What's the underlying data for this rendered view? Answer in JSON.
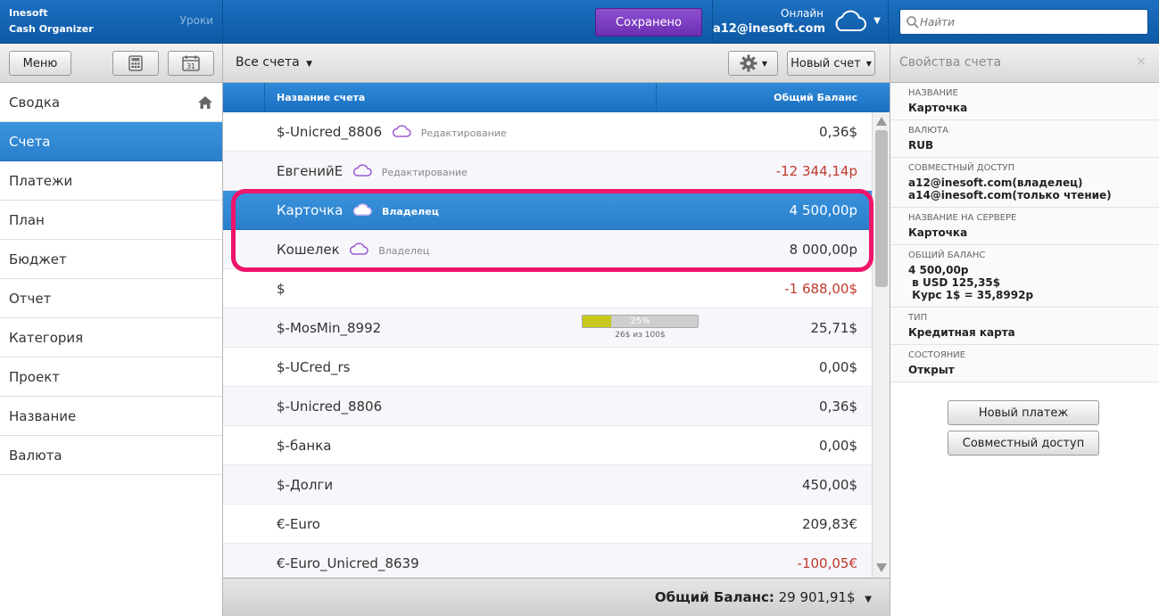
{
  "header": {
    "brand_line1": "Inesoft",
    "brand_line2": "Cash Organizer",
    "lessons_label": "Уроки",
    "saved_label": "Сохранено",
    "status_label": "Онлайн",
    "user_email": "a12@inesoft.com",
    "search_placeholder": "Найти",
    "saved_button_color": "#7b3fc4",
    "header_color": "#1565b8"
  },
  "toolbar": {
    "menu_label": "Меню",
    "calc_icon": "calculator-icon",
    "calendar_icon": "calendar-icon",
    "calendar_day": "31",
    "filter_label": "Все счета",
    "new_account_label": "Новый счет",
    "settings_icon": "gear-icon",
    "panel_title": "Свойства счета",
    "close_glyph": "×"
  },
  "sidebar": {
    "items": [
      {
        "label": "Сводка"
      },
      {
        "label": "Счета"
      },
      {
        "label": "Платежи"
      },
      {
        "label": "План"
      },
      {
        "label": "Бюджет"
      },
      {
        "label": "Отчет"
      },
      {
        "label": "Категория"
      },
      {
        "label": "Проект"
      },
      {
        "label": "Название"
      },
      {
        "label": "Валюта"
      }
    ]
  },
  "table": {
    "col_name": "Название счета",
    "col_balance": "Общий Баланс",
    "rows": [
      {
        "name": "$-Unicred_8806",
        "tag": "Редактирование",
        "balance": "0,36$"
      },
      {
        "name": "ЕвгенийЕ",
        "tag": "Редактирование",
        "balance": "-12 344,14р"
      },
      {
        "name": "Карточка",
        "tag": "Владелец",
        "balance": "4 500,00р"
      },
      {
        "name": "Кошелек",
        "tag": "Владелец",
        "balance": "8 000,00р"
      },
      {
        "name": "$",
        "balance": "-1 688,00$"
      },
      {
        "name": "$-MosMin_8992",
        "balance": "25,71$",
        "progress_label": "25%",
        "progress_sub": "26$ из 100$",
        "progress_fraction": 0.25
      },
      {
        "name": "$-UCred_rs",
        "balance": "0,00$"
      },
      {
        "name": "$-Unicred_8806",
        "balance": "0,36$"
      },
      {
        "name": "$-банка",
        "balance": "0,00$"
      },
      {
        "name": "$-Долги",
        "balance": "450,00$"
      },
      {
        "name": "€-Euro",
        "balance": "209,83€"
      },
      {
        "name": "€-Euro_Unicred_8639",
        "balance": "-100,05€"
      }
    ],
    "negative_color": "#c0392b",
    "selected_color": "#2f86d4",
    "highlight_color": "#f0146a"
  },
  "footer": {
    "total_label": "Общий Баланс:",
    "total_value": "29 901,91$"
  },
  "properties": {
    "fields": [
      {
        "key": "НАЗВАНИЕ",
        "value": "Карточка"
      },
      {
        "key": "ВАЛЮТА",
        "value": "RUB"
      },
      {
        "key": "СОВМЕСТНЫЙ ДОСТУП",
        "value": "a12@inesoft.com(владелец)\na14@inesoft.com(только чтение)"
      },
      {
        "key": "НАЗВАНИЕ НА СЕРВЕРЕ",
        "value": "Карточка"
      },
      {
        "key": "ОБЩИЙ БАЛАНС",
        "value": "4 500,00р\n в USD 125,35$\n Курс 1$ = 35,8992р"
      },
      {
        "key": "ТИП",
        "value": "Кредитная карта"
      },
      {
        "key": "СОСТОЯНИЕ",
        "value": "Открыт"
      }
    ],
    "new_payment_label": "Новый платеж",
    "shared_access_label": "Совместный доступ"
  }
}
